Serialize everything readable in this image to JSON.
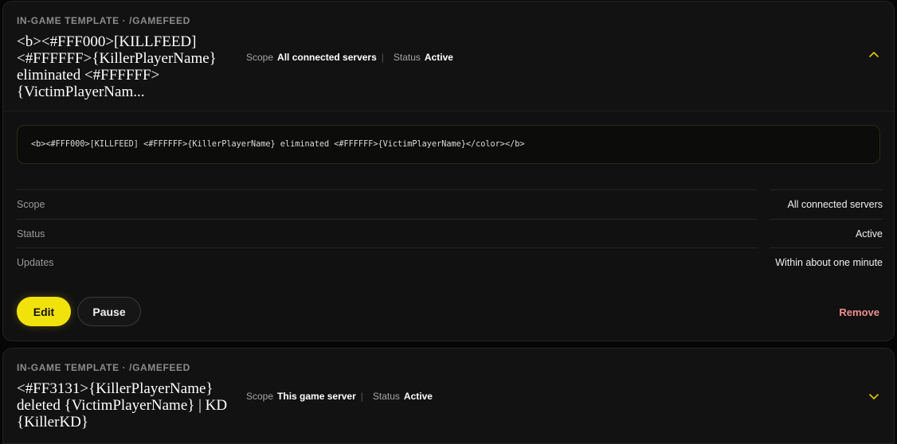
{
  "templates": [
    {
      "eyebrow": "IN-GAME TEMPLATE · /GAMEFEED",
      "title": "<b><#FFF000>[KILLFEED] <#FFFFFF>{KillerPlayerName} eliminated <#FFFFFF> {VictimPlayerNam...",
      "meta": {
        "scope_label": "Scope",
        "scope_value": "All connected servers",
        "separator": "|",
        "status_label": "Status",
        "status_value": "Active"
      },
      "expanded": true,
      "toggle_icon": "chevron-up-icon",
      "code": "<b><#FFF000>[KILLFEED] <#FFFFFF>{KillerPlayerName} eliminated <#FFFFFF>{VictimPlayerName}</color></b>",
      "details": [
        {
          "label": "Scope",
          "value": "All connected servers"
        },
        {
          "label": "Status",
          "value": "Active"
        },
        {
          "label": "Updates",
          "value": "Within about one minute"
        }
      ],
      "actions": {
        "edit": "Edit",
        "pause": "Pause",
        "remove": "Remove"
      }
    },
    {
      "eyebrow": "IN-GAME TEMPLATE · /GAMEFEED",
      "title": "<#FF3131>{KillerPlayerName} deleted {VictimPlayerName} | KD {KillerKD}",
      "meta": {
        "scope_label": "Scope",
        "scope_value": "This game server",
        "separator": "|",
        "status_label": "Status",
        "status_value": "Active"
      },
      "expanded": false,
      "toggle_icon": "chevron-down-icon"
    }
  ],
  "colors": {
    "accent": "#f2e20c",
    "chevron": "#e6c800",
    "danger": "#ef8f8f",
    "card_bg": "#111111",
    "page_bg": "#060606"
  }
}
